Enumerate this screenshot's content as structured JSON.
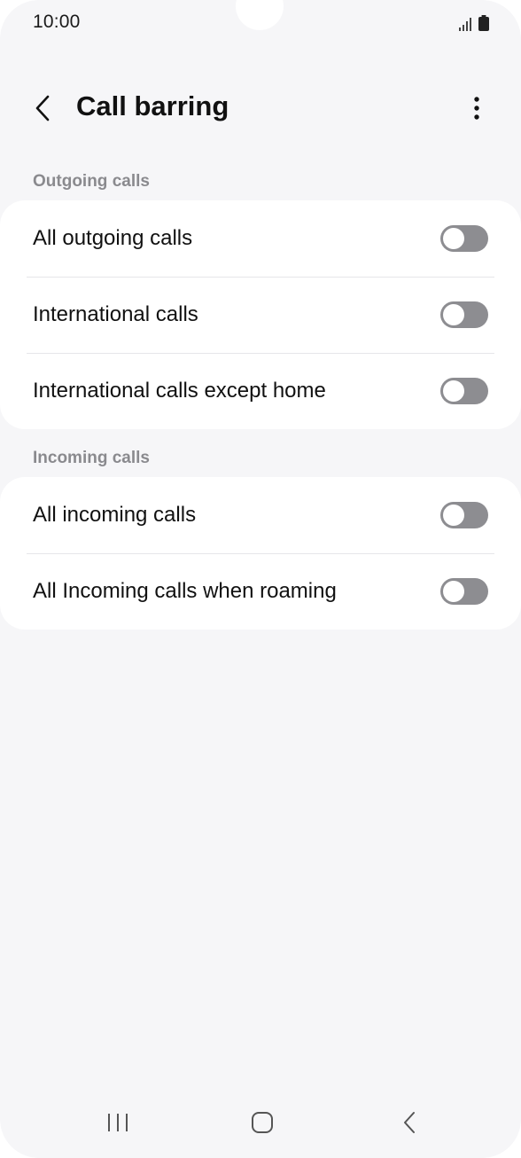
{
  "status_bar": {
    "time": "10:00",
    "icons": [
      "signal-icon",
      "battery-icon"
    ]
  },
  "app_bar": {
    "title": "Call barring",
    "back_icon": "chevron-left-icon",
    "more_icon": "more-vertical-icon"
  },
  "sections": [
    {
      "header": "Outgoing calls",
      "items": [
        {
          "label": "All outgoing calls",
          "enabled": false
        },
        {
          "label": "International calls",
          "enabled": false
        },
        {
          "label": "International calls except home",
          "enabled": false
        }
      ]
    },
    {
      "header": "Incoming calls",
      "items": [
        {
          "label": "All incoming calls",
          "enabled": false
        },
        {
          "label": "All Incoming calls when roaming",
          "enabled": false
        }
      ]
    }
  ],
  "nav_bar": {
    "buttons": [
      "recents-icon",
      "home-icon",
      "back-icon"
    ]
  },
  "colors": {
    "background": "#f6f6f8",
    "card": "#ffffff",
    "toggle_off": "#8d8d91",
    "section_header": "#8a8a8e"
  }
}
